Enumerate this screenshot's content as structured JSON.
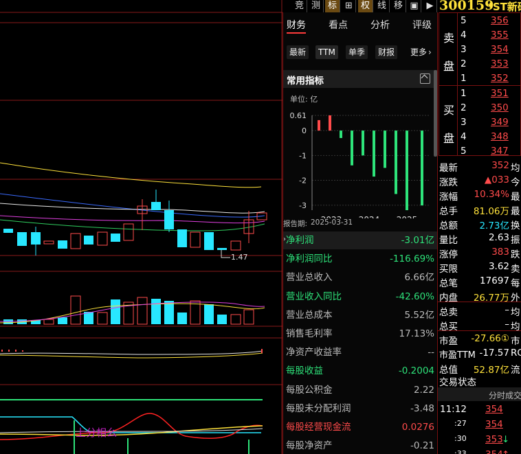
{
  "toolbar": {
    "buttons": [
      "竞",
      "测",
      "标",
      "⊞",
      "权",
      "线",
      "移",
      "▣",
      "▶"
    ],
    "code": "300159",
    "name": "*ST新研"
  },
  "chart": {
    "low_label": "1.47",
    "indicator_label": "上分相么"
  },
  "fin": {
    "tabs": [
      "财务",
      "看点",
      "分析",
      "评级"
    ],
    "subtabs": [
      "最新",
      "TTM",
      "单季",
      "财报",
      "更多"
    ],
    "section_title": "常用指标",
    "unit": "单位: 亿",
    "report_label": "报告期:",
    "report_date": "2025-03-31",
    "years": [
      "2023",
      "2024",
      "2025"
    ],
    "rows": [
      {
        "l": "净利润",
        "v": "-3.01亿",
        "lc": "green",
        "vc": "green"
      },
      {
        "l": "净利润同比",
        "v": "-116.69%",
        "lc": "green",
        "vc": "green"
      },
      {
        "l": "营业总收入",
        "v": "6.66亿",
        "lc": "gray",
        "vc": "gray"
      },
      {
        "l": "营业收入同比",
        "v": "-42.60%",
        "lc": "green",
        "vc": "green"
      },
      {
        "l": "营业总成本",
        "v": "5.52亿",
        "lc": "gray",
        "vc": "gray"
      },
      {
        "l": "销售毛利率",
        "v": "17.13%",
        "lc": "gray",
        "vc": "gray"
      },
      {
        "l": "净资产收益率",
        "v": "--",
        "lc": "gray",
        "vc": "gray"
      },
      {
        "l": "每股收益",
        "v": "-0.2004",
        "lc": "green",
        "vc": "green"
      },
      {
        "l": "每股公积金",
        "v": "2.22",
        "lc": "gray",
        "vc": "gray"
      },
      {
        "l": "每股未分配利润",
        "v": "-3.48",
        "lc": "gray",
        "vc": "gray"
      },
      {
        "l": "每股经营现金流",
        "v": "0.0276",
        "lc": "red",
        "vc": "red"
      },
      {
        "l": "每股净资产",
        "v": "-0.21",
        "lc": "gray",
        "vc": "gray"
      }
    ]
  },
  "chart_data": {
    "type": "bar",
    "unit": "单位: 亿",
    "yticks": [
      "0.61",
      "0",
      "-1",
      "-2",
      "-3"
    ],
    "ylim": [
      -3.2,
      0.61
    ],
    "xticks": [
      "2023",
      "2024",
      "2025"
    ],
    "values": [
      0.42,
      0.61,
      -0.3,
      -1.4,
      -1.0,
      -1.85,
      -1.5,
      -2.55,
      -3.2,
      -3.01
    ],
    "colors": {
      "pos": "#ff4b4b",
      "neg": "#2ee37a"
    }
  },
  "quote": {
    "sell_label": [
      "卖",
      "盘"
    ],
    "buy_label": [
      "买",
      "盘"
    ],
    "sell": [
      [
        "5",
        "356"
      ],
      [
        "4",
        "355"
      ],
      [
        "3",
        "354"
      ],
      [
        "2",
        "353"
      ],
      [
        "1",
        "352"
      ]
    ],
    "buy": [
      [
        "1",
        "351"
      ],
      [
        "2",
        "350"
      ],
      [
        "3",
        "349"
      ],
      [
        "4",
        "348"
      ],
      [
        "5",
        "347"
      ]
    ],
    "stats": [
      {
        "l": "最新",
        "v": "352",
        "t": "均",
        "vc": "red"
      },
      {
        "l": "涨跌",
        "v": "▲033",
        "t": "今",
        "vc": "red"
      },
      {
        "l": "涨幅",
        "v": "10.34%",
        "t": "最",
        "vc": "red"
      },
      {
        "l": "总手",
        "v": "81.06万",
        "t": "最",
        "vc": "yellow"
      },
      {
        "l": "总额",
        "v": "2.73亿",
        "t": "换",
        "vc": "cyan"
      },
      {
        "l": "量比",
        "v": "2.63",
        "t": "振",
        "vc": "white"
      },
      {
        "l": "涨停",
        "v": "383",
        "t": "跌",
        "vc": "red"
      },
      {
        "l": "买限",
        "v": "3.62",
        "t": "卖",
        "vc": "white"
      },
      {
        "l": "总笔",
        "v": "17697",
        "t": "每",
        "vc": "white"
      },
      {
        "l": "内盘",
        "v": "26.77万",
        "t": "外",
        "vc": "yellow"
      },
      {
        "l": "总卖",
        "v": "–",
        "t": "均",
        "vc": "white"
      },
      {
        "l": "总买",
        "v": "–",
        "t": "均",
        "vc": "white"
      },
      {
        "l": "市盈",
        "v": "-27.66①",
        "t": "市",
        "vc": "yellow"
      },
      {
        "l": "市盈TTM",
        "v": "-17.57",
        "t": "RO",
        "vc": "white"
      },
      {
        "l": "总值",
        "v": "52.87亿",
        "t": "流",
        "vc": "yellow"
      }
    ],
    "trade_status": "交易状态",
    "ticks_title": "分时成交",
    "ticks": [
      [
        "11:12",
        "354",
        ""
      ],
      [
        ":27",
        "354",
        ""
      ],
      [
        ":30",
        "353",
        "↓"
      ],
      [
        ":33",
        "354",
        "↑"
      ]
    ]
  }
}
